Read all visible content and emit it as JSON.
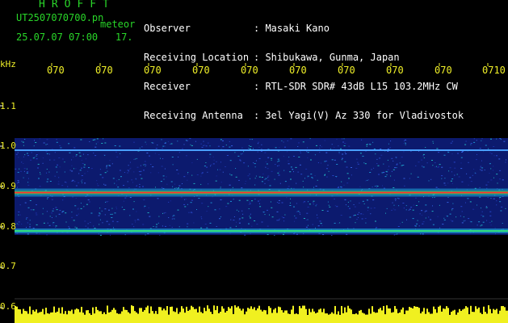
{
  "header": {
    "brand": "HROFFT",
    "file_id": "UT2507070700.pn",
    "mode": "meteor",
    "date_time": "25.07.07 07:00",
    "extra": "17.",
    "labels": [
      "Observer",
      "Receiving Location",
      "Receiver",
      "Receiving Antenna"
    ],
    "values": [
      ": Masaki Kano",
      ": Shibukawa, Gunma, Japan",
      ": RTL-SDR SDR# 43dB L15 103.2MHz CW",
      ": 3el Yagi(V) Az 330 for Vladivostok"
    ]
  },
  "axis": {
    "unit": "kHz",
    "y_ticks": [
      "1.1",
      "1.0",
      "0.9",
      "0.8",
      "0.7",
      "0.6"
    ],
    "time_ticks": [
      "070",
      "070",
      "070",
      "070",
      "070",
      "070",
      "070",
      "070",
      "070",
      "0710"
    ]
  },
  "colors": {
    "header_green": "#29d629",
    "header_white": "#ffffff",
    "tick_yellow": "#f0f028",
    "noise_blue": "#1a2fa0",
    "signal_red": "#ff3030"
  },
  "spectrogram": {
    "band_top_khz": 1.02,
    "band_bottom_khz": 0.78,
    "carrier_lines_khz": [
      0.99,
      0.885,
      0.79
    ]
  }
}
